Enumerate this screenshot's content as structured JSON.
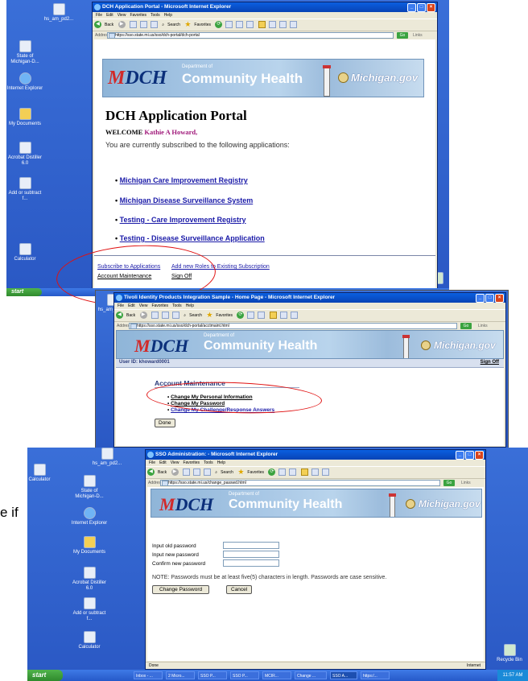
{
  "caption_fragment": "e if",
  "taskbar": {
    "start_label": "start"
  },
  "screen1": {
    "window_title": "DCH Application Portal - Microsoft Internet Explorer",
    "menus": [
      "File",
      "Edit",
      "View",
      "Favorites",
      "Tools",
      "Help"
    ],
    "toolbar": {
      "back": "Back",
      "search": "Search",
      "favorites": "Favorites"
    },
    "address_label": "Address",
    "address_url": "https://sso.state.mi.us/sso/dch-portal/dch-portal",
    "go": "Go",
    "links": "Links",
    "desktop_icons": [
      "hs_am_pd2...",
      "State of Michigan-D...",
      "Internet Explorer",
      "My Documents",
      "Acrobat Distiller 6.0",
      "Add or subtract f...",
      "Calculator"
    ],
    "banner": {
      "dept_small": "Department of",
      "dept_big": "Community Health",
      "michigan": "Michigan.gov",
      "logo_m": "M",
      "logo_rest": "DCH"
    },
    "page_title": "DCH Application Portal",
    "welcome_prefix": "WELCOME",
    "welcome_name": "Kathie A Howard,",
    "subscribed_text": "You are currently subscribed to the following applications:",
    "apps": [
      "Michigan Care Improvement Registry",
      "Michigan Disease Surveillance System",
      "Testing - Care Improvement Registry",
      "Testing - Disease Surveillance Application"
    ],
    "footer_links": {
      "subscribe": "Subscribe to Applications",
      "add_roles": "Add new Roles to Existing Subscription",
      "account": "Account Maintenance",
      "signoff": "Sign Off"
    }
  },
  "screen2": {
    "window_title": "Tivoli Identity Products Integration Sample - Home Page - Microsoft Internet Explorer",
    "address_url": "https://sso.state.mi.us/sso/dch-portal/acctmaint.html",
    "user_id": "User ID: khoward0001",
    "signoff": "Sign Off",
    "heading": "Account Maintenance",
    "items": [
      "Change My Personal Information",
      "Change My Password",
      "Change My Challenge/Response Answers"
    ],
    "done": "Done"
  },
  "screen3": {
    "window_title": "SSO Administration: - Microsoft Internet Explorer",
    "address_url": "https://sso.state.mi.us/change_passwd.html",
    "fields": [
      "Input old password",
      "Input new password",
      "Confirm new password"
    ],
    "note": "NOTE: Passwords must be at least five(5) characters in length. Passwords are case sensitive.",
    "change_btn": "Change Password",
    "cancel_btn": "Cancel",
    "status_left": "Done",
    "status_right": "Internet",
    "recycle": "Recycle Bin",
    "clock": "11:57 AM",
    "taskbar_items": [
      "Inbox - ...",
      "2 Micro...",
      "SSO P...",
      "SSO P...",
      "MCIR...",
      "Change ...",
      "SSO A...",
      "https:/..."
    ]
  }
}
